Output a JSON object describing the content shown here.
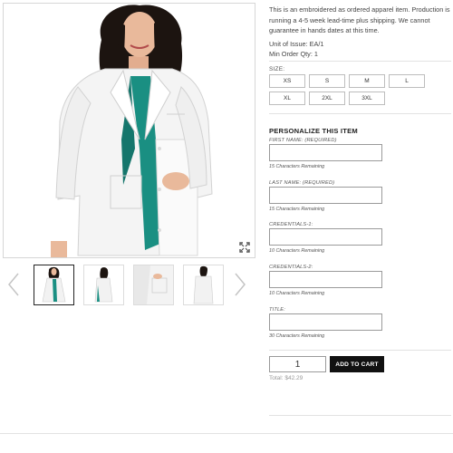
{
  "product": {
    "description": "This is an embroidered as ordered apparel item. Production is running a 4-5 week lead-time plus shipping. We cannot guarantee in hands dates at this time.",
    "unit_of_issue": "Unit of Issue: EA/1",
    "min_order_qty": "Min Order Qty: 1"
  },
  "size": {
    "label": "SIZE:",
    "options": [
      "XS",
      "S",
      "M",
      "L",
      "XL",
      "2XL",
      "3XL"
    ]
  },
  "personalize": {
    "title": "PERSONALIZE THIS ITEM",
    "fields": [
      {
        "label": "FIRST NAME: (REQUIRED)",
        "value": "",
        "hint": "15 Characters Remaining"
      },
      {
        "label": "LAST NAME: (REQUIRED)",
        "value": "",
        "hint": "15 Characters Remaining"
      },
      {
        "label": "CREDENTIALS-1:",
        "value": "",
        "hint": "10 Characters Remaining"
      },
      {
        "label": "CREDENTIALS-2:",
        "value": "",
        "hint": "10 Characters Remaining"
      },
      {
        "label": "TITLE:",
        "value": "",
        "hint": "30 Characters Remaining"
      }
    ]
  },
  "cart": {
    "quantity": "1",
    "add_label": "ADD TO CART",
    "total": "Total: $42.29"
  },
  "gallery": {
    "icons": {
      "zoom": "expand-icon",
      "prev": "chevron-left-icon",
      "next": "chevron-right-icon"
    },
    "colors": {
      "scrubs": "#1a8f82",
      "coat": "#f4f4f4",
      "hair": "#1c1410",
      "skin": "#e9b99b"
    },
    "thumb_count": 4
  }
}
